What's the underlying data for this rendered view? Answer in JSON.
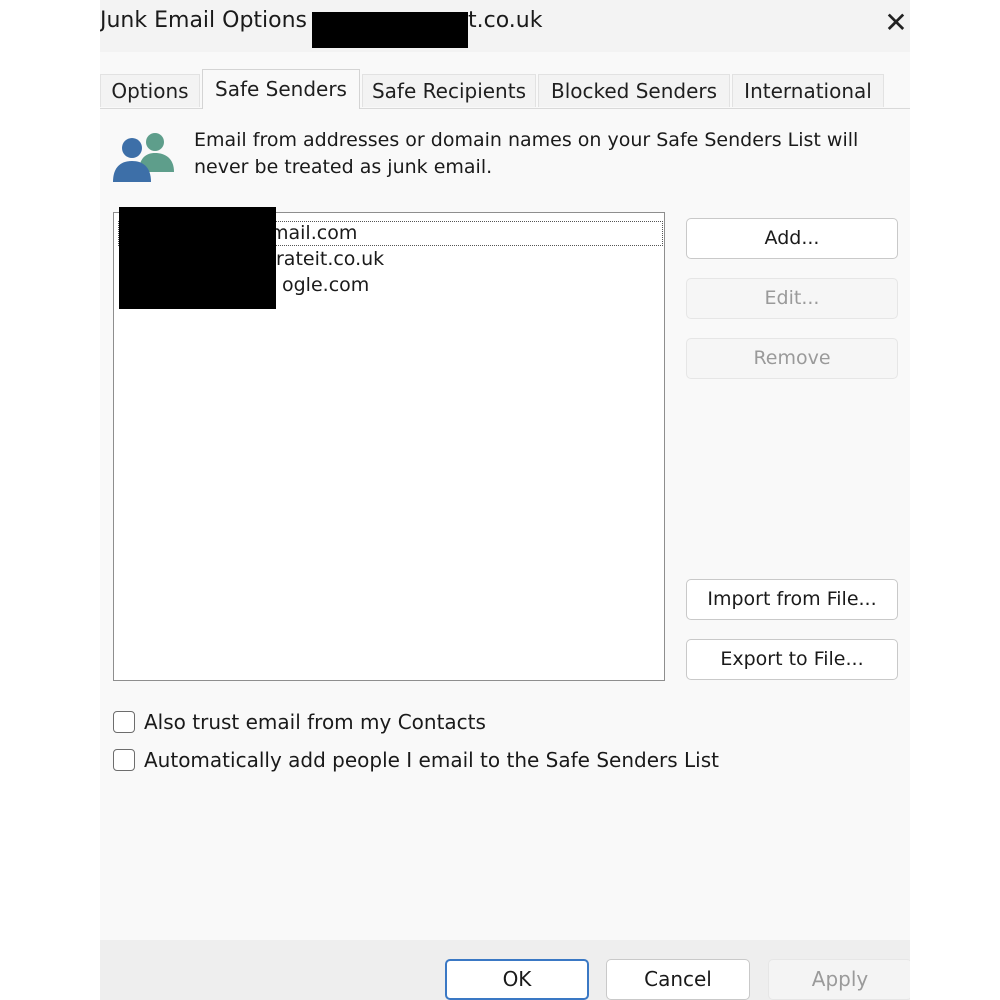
{
  "window": {
    "title": "Junk Email Options -",
    "title_suffix": "t.co.uk",
    "close_icon": "close-icon"
  },
  "tabs": [
    {
      "label": "Options",
      "active": false
    },
    {
      "label": "Safe Senders",
      "active": true
    },
    {
      "label": "Safe Recipients",
      "active": false
    },
    {
      "label": "Blocked Senders",
      "active": false
    },
    {
      "label": "International",
      "active": false
    }
  ],
  "description": {
    "icon": "people-icon",
    "text": "Email from addresses or domain names on your Safe Senders List will never be treated as junk email."
  },
  "safe_senders_list": {
    "items": [
      {
        "visible_text": "mail.com",
        "selected": true
      },
      {
        "visible_text": "rateit.co.uk",
        "selected": false
      },
      {
        "visible_text": "ogle.com",
        "selected": false
      }
    ]
  },
  "side_buttons": {
    "add": {
      "label": "Add...",
      "enabled": true
    },
    "edit": {
      "label": "Edit...",
      "enabled": false
    },
    "remove": {
      "label": "Remove",
      "enabled": false
    },
    "import": {
      "label": "Import from File...",
      "enabled": true
    },
    "export": {
      "label": "Export to File...",
      "enabled": true
    }
  },
  "options": {
    "trust_contacts": {
      "label": "Also trust email from my Contacts",
      "checked": false
    },
    "auto_add": {
      "label": "Automatically add people I email to the Safe Senders List",
      "checked": false
    }
  },
  "footer": {
    "ok": {
      "label": "OK",
      "enabled": true
    },
    "cancel": {
      "label": "Cancel",
      "enabled": true
    },
    "apply": {
      "label": "Apply",
      "enabled": false
    }
  },
  "colors": {
    "dialog_bg": "#f9f9f9",
    "default_button_border": "#3a78c4",
    "disabled_text": "#9a9a9a",
    "icon_blue": "#3d6fa8",
    "icon_green": "#5e9e8b"
  }
}
